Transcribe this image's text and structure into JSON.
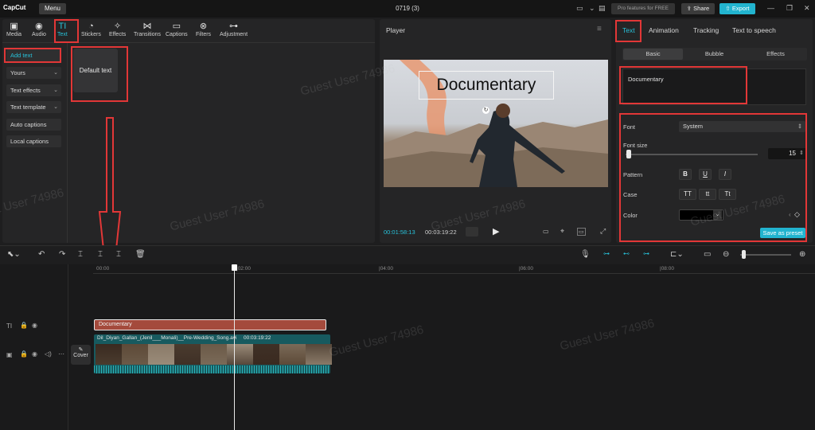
{
  "app": {
    "logo": "CapCut",
    "menu": "Menu",
    "title": "0719 (3)",
    "pro": "Pro features for FREE",
    "share": "Share",
    "export": "Export"
  },
  "toolbar": [
    {
      "label": "Media",
      "icon": "media-icon",
      "glyph": "▣"
    },
    {
      "label": "Audio",
      "icon": "audio-icon",
      "glyph": "◉"
    },
    {
      "label": "Text",
      "icon": "text-icon",
      "glyph": "TI"
    },
    {
      "label": "Stickers",
      "icon": "sticker-icon",
      "glyph": "◔"
    },
    {
      "label": "Effects",
      "icon": "effects-icon",
      "glyph": "✧"
    },
    {
      "label": "Transitions",
      "icon": "transitions-icon",
      "glyph": "⋈"
    },
    {
      "label": "Captions",
      "icon": "captions-icon",
      "glyph": "▭"
    },
    {
      "label": "Filters",
      "icon": "filters-icon",
      "glyph": "⊗"
    },
    {
      "label": "Adjustment",
      "icon": "adjustment-icon",
      "glyph": "⊶"
    }
  ],
  "sidebar": {
    "add_text": "Add text",
    "yours": "Yours",
    "text_effects": "Text effects",
    "text_template": "Text template",
    "auto_captions": "Auto captions",
    "local_captions": "Local captions"
  },
  "default_text": "Default text",
  "player": {
    "title": "Player",
    "overlay_text": "Documentary",
    "current_time": "00:01:58:13",
    "total_time": "00:03:19:22"
  },
  "right": {
    "tabs": [
      "Text",
      "Animation",
      "Tracking",
      "Text to speech"
    ],
    "subtabs": [
      "Basic",
      "Bubble",
      "Effects"
    ],
    "text_value": "Documentary",
    "font_label": "Font",
    "font_value": "System",
    "size_label": "Font size",
    "size_value": "15",
    "pattern_label": "Pattern",
    "bold": "B",
    "underline": "U",
    "italic": "I",
    "case_label": "Case",
    "case_upper": "TT",
    "case_lower": "tt",
    "case_title": "Tt",
    "color_label": "Color",
    "save_preset": "Save as preset"
  },
  "timeline": {
    "ruler": [
      "00:00",
      "|02:00",
      "|04:00",
      "|06:00",
      "|08:00"
    ],
    "text_clip": "Documentary",
    "video_name": "Dil_Diyan_Gallan_(Jenil___Monali)__Pre-Wedding_Song.avi",
    "video_duration": "00:03:19:22",
    "cover": "Cover"
  },
  "watermark": "Guest User 74986",
  "colors": {
    "accent": "#22b4cf",
    "highlight": "#e23737",
    "text_clip": "#a44a3c",
    "video_track": "#175a5f"
  }
}
